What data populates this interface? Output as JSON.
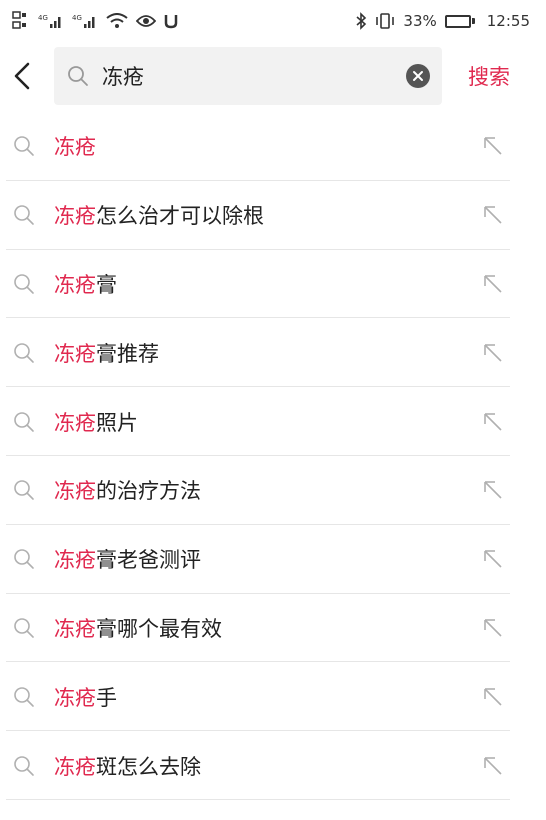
{
  "status_bar": {
    "network_left": "4G",
    "network_right": "4G",
    "battery_percent": "33%",
    "battery_level": 0.33,
    "time": "12:55"
  },
  "header": {
    "back_icon": "back-arrow-icon",
    "search_value": "冻疮",
    "search_icon": "search-icon",
    "clear_icon": "clear-icon",
    "search_button_label": "搜索"
  },
  "suggestions": [
    {
      "highlight": "冻疮",
      "rest": ""
    },
    {
      "highlight": "冻疮",
      "rest": "怎么治才可以除根"
    },
    {
      "highlight": "冻疮",
      "rest": "膏"
    },
    {
      "highlight": "冻疮",
      "rest": "膏推荐"
    },
    {
      "highlight": "冻疮",
      "rest": "照片"
    },
    {
      "highlight": "冻疮",
      "rest": "的治疗方法"
    },
    {
      "highlight": "冻疮",
      "rest": "膏老爸测评"
    },
    {
      "highlight": "冻疮",
      "rest": "膏哪个最有效"
    },
    {
      "highlight": "冻疮",
      "rest": "手"
    },
    {
      "highlight": "冻疮",
      "rest": "斑怎么去除"
    }
  ],
  "colors": {
    "accent": "#e0294f",
    "text": "#222222",
    "icon_gray": "#b0b0b0",
    "divider": "#e6e6e6",
    "search_bg": "#f2f2f2"
  }
}
